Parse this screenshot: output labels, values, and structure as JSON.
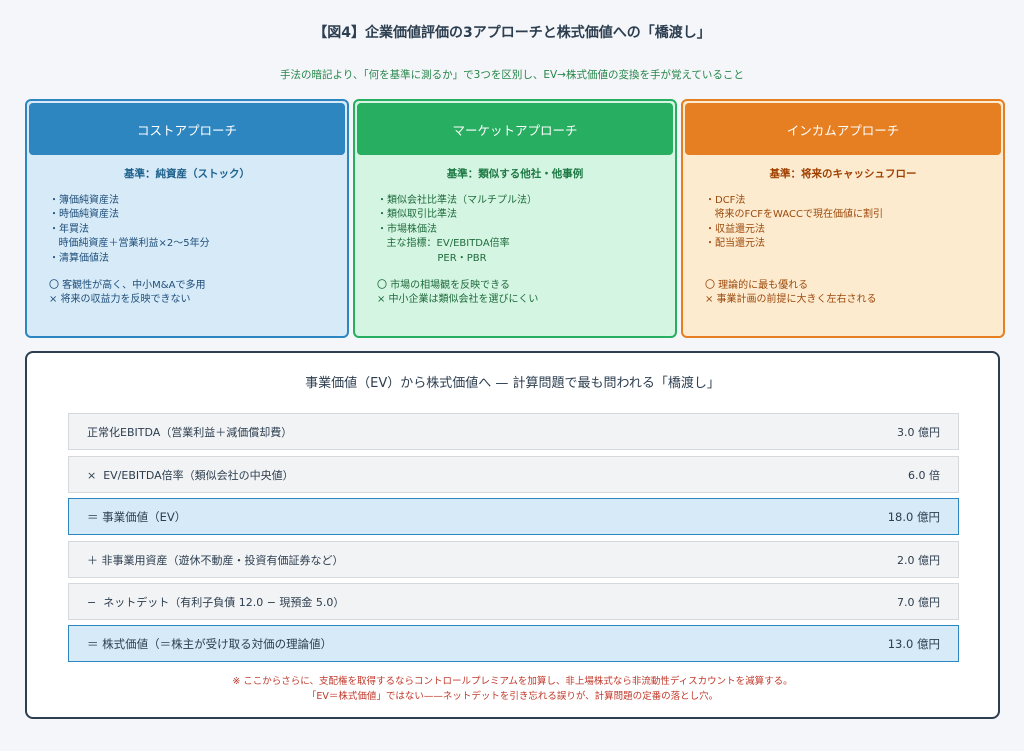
{
  "title": "【図4】企業価値評価の3アプローチと株式価値への「橋渡し」",
  "subtitle": "手法の暗記より、「何を基準に測るか」で3つを区別し、EV→株式価値の変換を手が覚えていること",
  "approaches": [
    {
      "name": "コストアプローチ",
      "basis": "基準：純資産（ストック）",
      "items": [
        "・簿価純資産法",
        "・時価純資産法",
        "・年買法",
        "   時価純資産＋営業利益×2〜5年分",
        "・清算価値法"
      ],
      "pros": [
        "〇 客観性が高く、中小M&Aで多用",
        "× 将来の収益力を反映できない"
      ],
      "color": "#2e86c1"
    },
    {
      "name": "マーケットアプローチ",
      "basis": "基準：類似する他社・他事例",
      "items": [
        "・類似会社比準法（マルチプル法）",
        "・類似取引比準法",
        "・市場株価法",
        "   主な指標：EV/EBITDA倍率",
        "                   PER・PBR"
      ],
      "pros": [
        "〇 市場の相場観を反映できる",
        "× 中小企業は類似会社を選びにくい"
      ],
      "color": "#27ae60"
    },
    {
      "name": "インカムアプローチ",
      "basis": "基準：将来のキャッシュフロー",
      "items": [
        "・DCF法",
        "   将来のFCFをWACCで現在価値に割引",
        "・収益還元法",
        "・配当還元法"
      ],
      "pros": [
        "〇 理論的に最も優れる",
        "× 事業計画の前提に大きく左右される"
      ],
      "color": "#e67e22"
    }
  ],
  "bridge": {
    "title": "事業価値（EV）から株式価値へ — 計算問題で最も問われる「橋渡し」",
    "rows": [
      {
        "label": "正常化EBITDA（営業利益＋減価償却費）",
        "value": "3.0 億円",
        "highlight": false
      },
      {
        "label": "×  EV/EBITDA倍率（類似会社の中央値）",
        "value": "6.0 倍",
        "highlight": false
      },
      {
        "label": "＝ 事業価値（EV）",
        "value": "18.0 億円",
        "highlight": true
      },
      {
        "label": "＋ 非事業用資産（遊休不動産・投資有価証券など）",
        "value": "2.0 億円",
        "highlight": false
      },
      {
        "label": "−  ネットデット（有利子負債 12.0 − 現預金 5.0）",
        "value": "7.0 億円",
        "highlight": false
      },
      {
        "label": "＝ 株式価値（＝株主が受け取る対価の理論値）",
        "value": "13.0 億円",
        "highlight": true
      }
    ],
    "notes": [
      "※ ここからさらに、支配権を取得するならコントロールプレミアムを加算し、非上場株式なら非流動性ディスカウントを減算する。",
      "「EV＝株式価値」ではない——ネットデットを引き忘れる誤りが、計算問題の定番の落とし穴。"
    ]
  }
}
